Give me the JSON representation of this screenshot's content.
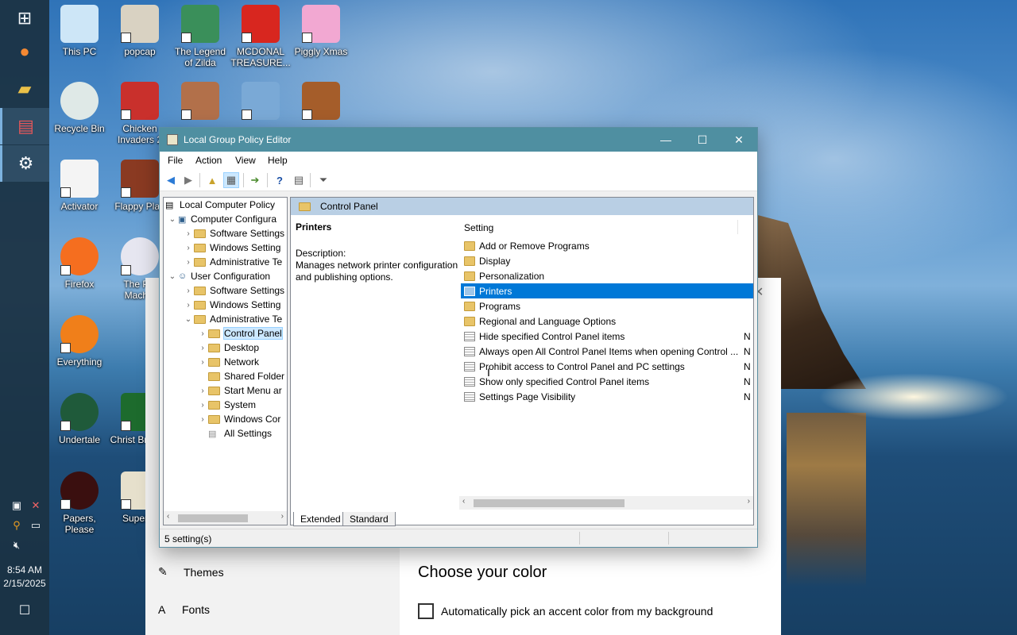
{
  "taskbar": {
    "buttons": [
      "windows-start-icon",
      "firefox-icon",
      "file-explorer-icon",
      "app-icon",
      "settings-gear-icon"
    ],
    "clock_time": "8:54 AM",
    "clock_date": "2/15/2025"
  },
  "desktop": {
    "icons": [
      {
        "label": "This PC"
      },
      {
        "label": "popcap"
      },
      {
        "label": "The Legend of Zilda"
      },
      {
        "label": "MCDONAL TREASURE..."
      },
      {
        "label": "Piggly Xmas"
      },
      {
        "label": "Recycle Bin"
      },
      {
        "label": "Chicken Invaders 2"
      },
      {
        "label": "Activator"
      },
      {
        "label": "Flappy Plan"
      },
      {
        "label": "Firefox"
      },
      {
        "label": "The Pol Machin"
      },
      {
        "label": "Everything"
      },
      {
        "label": "Undertale"
      },
      {
        "label": "Christ Browse"
      },
      {
        "label": "Papers, Please"
      },
      {
        "label": "Super H"
      }
    ]
  },
  "settings_window": {
    "nav_themes": "Themes",
    "nav_fonts": "Fonts",
    "heading": "Choose your color",
    "checkbox_label": "Automatically pick an accent color from my background"
  },
  "gpe": {
    "title": "Local Group Policy Editor",
    "menu": [
      "File",
      "Action",
      "View",
      "Help"
    ],
    "tree": [
      {
        "label": "Local Computer Policy"
      },
      {
        "label": "Computer Configura"
      },
      {
        "label": "Software Settings"
      },
      {
        "label": "Windows Setting"
      },
      {
        "label": "Administrative Te"
      },
      {
        "label": "User Configuration"
      },
      {
        "label": "Software Settings"
      },
      {
        "label": "Windows Setting"
      },
      {
        "label": "Administrative Te"
      },
      {
        "label": "Control Panel"
      },
      {
        "label": "Desktop"
      },
      {
        "label": "Network"
      },
      {
        "label": "Shared Folder"
      },
      {
        "label": "Start Menu ar"
      },
      {
        "label": "System"
      },
      {
        "label": "Windows Cor"
      },
      {
        "label": "All Settings"
      }
    ],
    "pane_header": "Control Panel",
    "detail_title": "Printers",
    "description_label": "Description:",
    "description_text": "Manages network printer configuration and publishing options.",
    "column_setting": "Setting",
    "rows": [
      {
        "label": "Add or Remove Programs",
        "state": ""
      },
      {
        "label": "Display",
        "state": ""
      },
      {
        "label": "Personalization",
        "state": ""
      },
      {
        "label": "Printers",
        "state": ""
      },
      {
        "label": "Programs",
        "state": ""
      },
      {
        "label": "Regional and Language Options",
        "state": ""
      },
      {
        "label": "Hide specified Control Panel items",
        "state": "N"
      },
      {
        "label": "Always open All Control Panel Items when opening Control ...",
        "state": "N"
      },
      {
        "label": "Prohibit access to Control Panel and PC settings",
        "state": "N"
      },
      {
        "label": "Show only specified Control Panel items",
        "state": "N"
      },
      {
        "label": "Settings Page Visibility",
        "state": "N"
      }
    ],
    "tab_extended": "Extended",
    "tab_standard": "Standard",
    "status": "5 setting(s)"
  }
}
